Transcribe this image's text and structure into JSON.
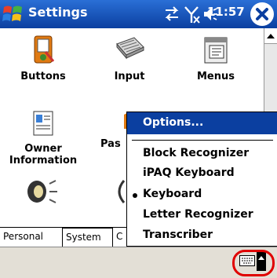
{
  "titlebar": {
    "title": "Settings",
    "clock": "11:57",
    "icons": [
      "windows-start-icon",
      "connectivity-icon",
      "no-signal-icon",
      "speaker-icon",
      "close-icon"
    ]
  },
  "grid": {
    "items": [
      {
        "label": "Buttons",
        "icon": "buttons-icon"
      },
      {
        "label": "Input",
        "icon": "keyboard-icon"
      },
      {
        "label": "Menus",
        "icon": "menus-icon"
      },
      {
        "label_line1": "Owner",
        "label_line2": "Information",
        "icon": "owner-info-icon"
      },
      {
        "label": "Pas",
        "icon": "password-icon"
      },
      {
        "label": "",
        "icon": "sounds-icon"
      },
      {
        "label": "",
        "icon": "today-icon"
      }
    ]
  },
  "tabs": [
    {
      "label": "Personal",
      "active": true
    },
    {
      "label": "System",
      "active": false
    },
    {
      "label": "C",
      "active": false
    }
  ],
  "menu": {
    "header": "Options...",
    "items": [
      {
        "label": "Block Recognizer",
        "selected": false
      },
      {
        "label": "iPAQ Keyboard",
        "selected": false
      },
      {
        "label": "Keyboard",
        "selected": true
      },
      {
        "label": "Letter Recognizer",
        "selected": false
      },
      {
        "label": "Transcriber",
        "selected": false
      }
    ]
  },
  "colors": {
    "titlebar": "#0b3fa0",
    "menu_highlight": "#0b3fa0",
    "highlight_ring": "#e00000"
  }
}
